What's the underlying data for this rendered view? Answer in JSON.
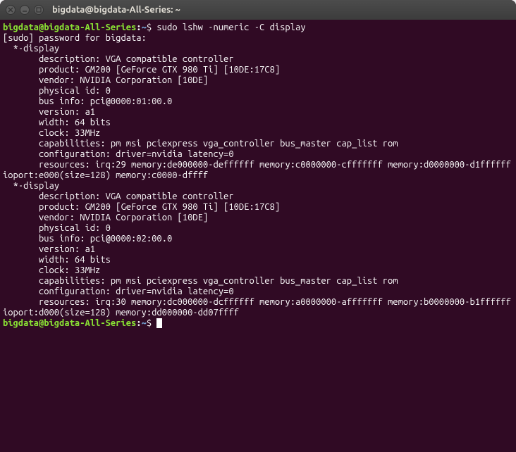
{
  "window": {
    "title": "bigdata@bigdata-All-Series: ~"
  },
  "prompt": {
    "user_host": "bigdata@bigdata-All-Series",
    "sep": ":",
    "path": "~",
    "symbol": "$"
  },
  "command": "sudo lshw -numeric -C display",
  "output": {
    "sudo_line": "[sudo] password for bigdata: ",
    "display1": {
      "header": "  *-display",
      "description": "       description: VGA compatible controller",
      "product": "       product: GM200 [GeForce GTX 980 Ti] [10DE:17C8]",
      "vendor": "       vendor: NVIDIA Corporation [10DE]",
      "physical_id": "       physical id: 0",
      "bus_info": "       bus info: pci@0000:01:00.0",
      "version": "       version: a1",
      "width": "       width: 64 bits",
      "clock": "       clock: 33MHz",
      "capabilities": "       capabilities: pm msi pciexpress vga_controller bus_master cap_list rom",
      "configuration": "       configuration: driver=nvidia latency=0",
      "resources": "       resources: irq:29 memory:de000000-deffffff memory:c0000000-cfffffff memory:d0000000-d1ffffff ioport:e000(size=128) memory:c0000-dffff"
    },
    "display2": {
      "header": "  *-display",
      "description": "       description: VGA compatible controller",
      "product": "       product: GM200 [GeForce GTX 980 Ti] [10DE:17C8]",
      "vendor": "       vendor: NVIDIA Corporation [10DE]",
      "physical_id": "       physical id: 0",
      "bus_info": "       bus info: pci@0000:02:00.0",
      "version": "       version: a1",
      "width": "       width: 64 bits",
      "clock": "       clock: 33MHz",
      "capabilities": "       capabilities: pm msi pciexpress vga_controller bus_master cap_list rom",
      "configuration": "       configuration: driver=nvidia latency=0",
      "resources": "       resources: irq:30 memory:dc000000-dcffffff memory:a0000000-afffffff memory:b0000000-b1ffffff ioport:d000(size=128) memory:dd000000-dd07ffff"
    }
  }
}
